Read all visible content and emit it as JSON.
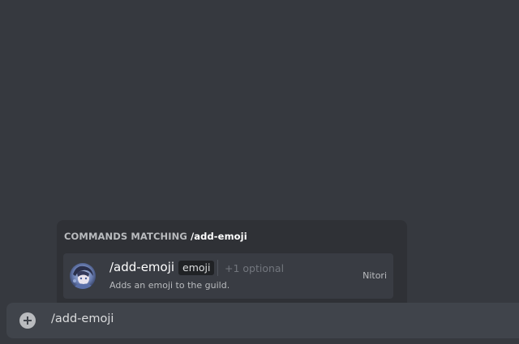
{
  "autocomplete": {
    "header_prefix": "COMMANDS MATCHING",
    "header_query": "/add-emoji",
    "commands": [
      {
        "name": "/add-emoji",
        "option": "emoji",
        "optional_count": "+1 optional",
        "description": "Adds an emoji to the guild.",
        "source": "Nitori",
        "avatar_icon": "bot-avatar-anime-character"
      }
    ]
  },
  "chat_input": {
    "value": "/add-emoji",
    "attach_icon": "plus-circle-icon"
  },
  "colors": {
    "background": "#36393f",
    "popup_background": "#2f3136",
    "item_selected": "#393c43",
    "input_background": "#40444b",
    "pill_background": "#202225"
  }
}
